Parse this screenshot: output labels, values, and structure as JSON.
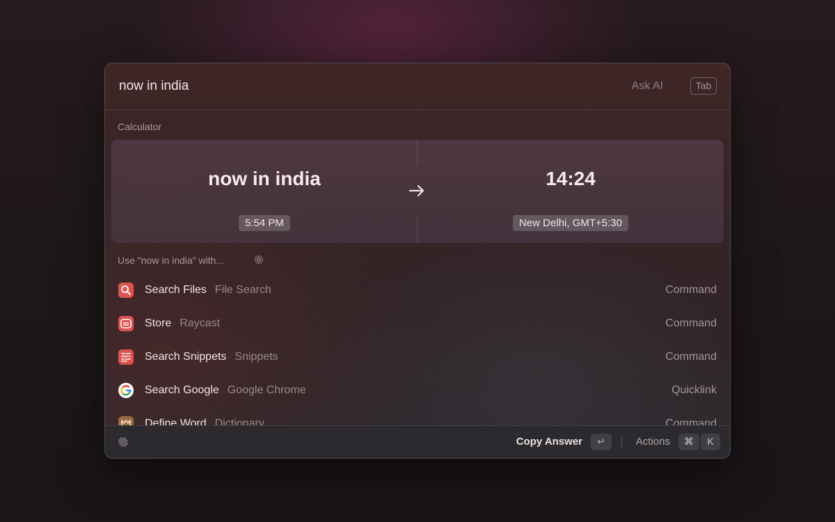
{
  "search": {
    "value": "now in india",
    "ask_ai_label": "Ask AI",
    "ask_ai_key": "Tab"
  },
  "calculator": {
    "section_title": "Calculator",
    "input": {
      "main": "now in india",
      "detail": "5:54 PM"
    },
    "output": {
      "main": "14:24",
      "detail": "New Delhi, GMT+5:30"
    },
    "arrow_icon": "arrow-right-icon"
  },
  "fallback": {
    "section_title": "Use \"now in india\" with...",
    "settings_icon": "gear-icon"
  },
  "list": {
    "items": [
      {
        "title": "Search Files",
        "subtitle": "File Search",
        "type": "Command",
        "icon": "search-files-icon",
        "icon_color": "#e0524f"
      },
      {
        "title": "Store",
        "subtitle": "Raycast",
        "type": "Command",
        "icon": "store-icon",
        "icon_color": "#e0524f"
      },
      {
        "title": "Search Snippets",
        "subtitle": "Snippets",
        "type": "Command",
        "icon": "snippets-icon",
        "icon_color": "#e0524f"
      },
      {
        "title": "Search Google",
        "subtitle": "Google Chrome",
        "type": "Quicklink",
        "icon": "google-icon",
        "icon_color": "#ffffff"
      },
      {
        "title": "Define Word",
        "subtitle": "Dictionary",
        "type": "Command",
        "icon": "dictionary-icon",
        "icon_color": "#9a6a43"
      }
    ]
  },
  "footer": {
    "primary_action": "Copy Answer",
    "primary_key": "↵",
    "actions_label": "Actions",
    "actions_key_1": "⌘",
    "actions_key_2": "K"
  }
}
